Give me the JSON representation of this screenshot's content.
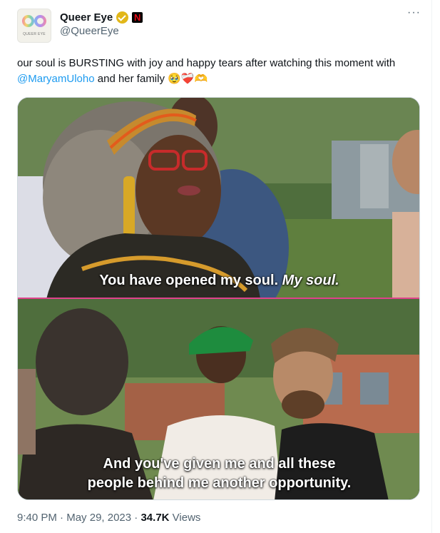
{
  "author": {
    "avatar_text": "qe",
    "avatar_subtext": "QUEER EYE",
    "display_name": "Queer Eye",
    "handle": "@QueerEye",
    "affiliation_badge": "N",
    "verified_icon": "gold-verified-check-icon"
  },
  "tweet": {
    "text_before": "our soul is BURSTING with joy and happy tears after watching this moment with ",
    "mention": "@MaryamUloho",
    "text_after": " and her family ",
    "emojis": "🥹❤️‍🩹🫶"
  },
  "media": {
    "top_caption_plain": "You have opened my soul. ",
    "top_caption_italic": "My soul.",
    "bottom_caption_line1": "And you've given me and all these",
    "bottom_caption_line2": "people behind me another opportunity."
  },
  "meta": {
    "time": "9:40 PM",
    "separator": " · ",
    "date": "May 29, 2023",
    "views_count": "34.7K",
    "views_label": " Views"
  },
  "colors": {
    "link": "#1d9bf0",
    "secondary_text": "#536471",
    "verified": "#e2b719",
    "caption_divider": "#e0428c"
  }
}
